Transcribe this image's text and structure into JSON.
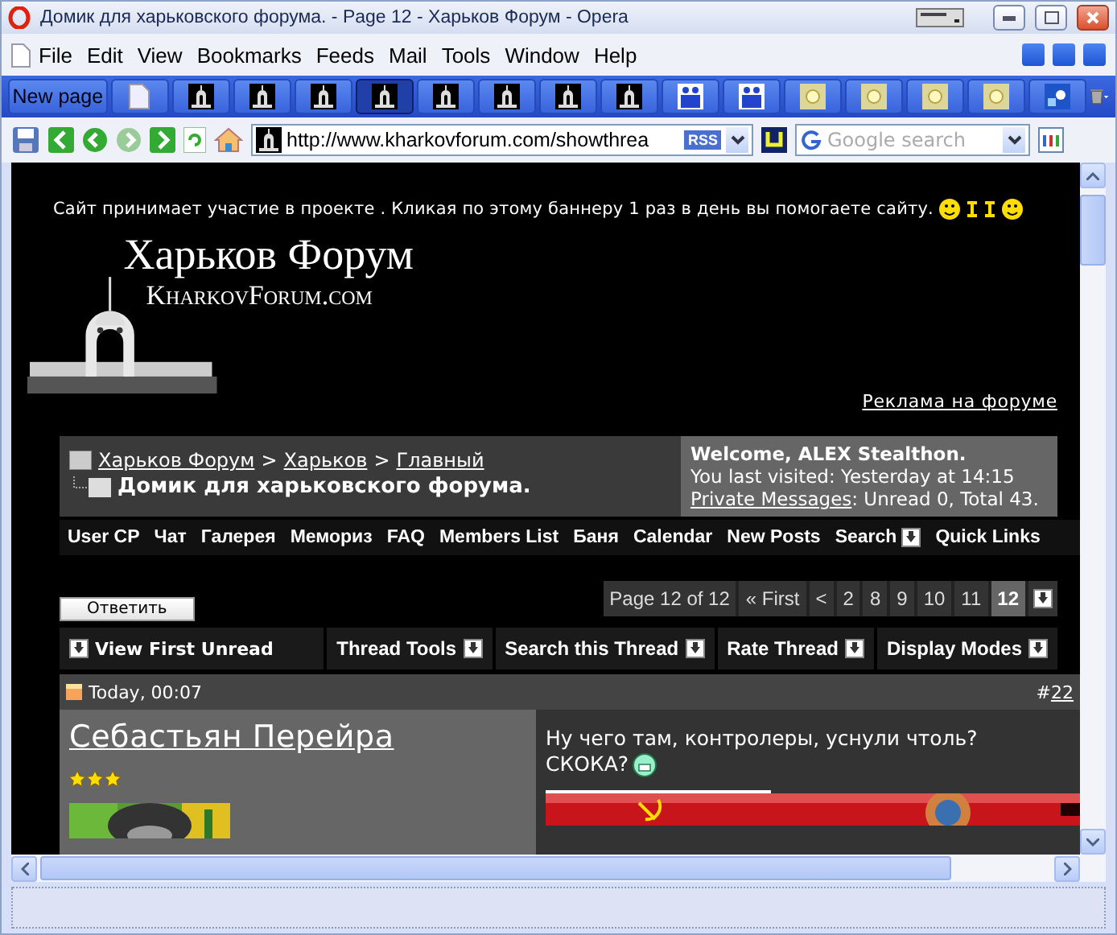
{
  "window": {
    "title": "Домик для харьковского форума. - Page 12 - Харьков Форум - Opera"
  },
  "menu": [
    "File",
    "Edit",
    "View",
    "Bookmarks",
    "Feeds",
    "Mail",
    "Tools",
    "Window",
    "Help"
  ],
  "tabs": [
    {
      "kind": "page",
      "label": "New page",
      "selected": false
    },
    {
      "kind": "blank",
      "selected": false
    },
    {
      "kind": "forum",
      "selected": false
    },
    {
      "kind": "forum",
      "selected": false
    },
    {
      "kind": "forum",
      "selected": false
    },
    {
      "kind": "forum",
      "selected": true
    },
    {
      "kind": "forum",
      "selected": false
    },
    {
      "kind": "forum",
      "selected": false
    },
    {
      "kind": "forum",
      "selected": false
    },
    {
      "kind": "forum",
      "selected": false
    },
    {
      "kind": "people",
      "selected": false
    },
    {
      "kind": "people",
      "selected": false
    },
    {
      "kind": "sun",
      "selected": false
    },
    {
      "kind": "sun",
      "selected": false
    },
    {
      "kind": "sun",
      "selected": false
    },
    {
      "kind": "sun",
      "selected": false
    },
    {
      "kind": "puzzle",
      "selected": false
    }
  ],
  "address": {
    "url": "http://www.kharkovforum.com/showthrea",
    "feed_badge": "RSS",
    "search_placeholder": "Google search"
  },
  "page": {
    "banner_notice": "Сайт принимает участие в проекте . Кликая по этому баннеру 1 раз в день вы помогаете сайту.",
    "logo_title": "Харьков Форум",
    "logo_subtitle": "KharkovForum.com",
    "ad_link": "Реклама на форуме",
    "breadcrumb_separator": ">",
    "breadcrumb": [
      "Харьков Форум",
      "Харьков",
      "Главный"
    ],
    "thread_title": "Домик для харьковского форума.",
    "welcome": {
      "greeting": "Welcome, ALEX Stealthon.",
      "last_visit": "You last visited: Yesterday at 14:15",
      "pm_link": "Private Messages",
      "pm_status": ": Unread 0, Total 43."
    },
    "nav": [
      {
        "label": "User CP",
        "menu": false
      },
      {
        "label": "Чат",
        "menu": false
      },
      {
        "label": "Галерея",
        "menu": false
      },
      {
        "label": "Мемориз",
        "menu": false
      },
      {
        "label": "FAQ",
        "menu": false
      },
      {
        "label": "Members List",
        "menu": false
      },
      {
        "label": "Баня",
        "menu": false
      },
      {
        "label": "Calendar",
        "menu": false
      },
      {
        "label": "New Posts",
        "menu": false
      },
      {
        "label": "Search",
        "menu": true
      },
      {
        "label": "Quick Links",
        "menu": false
      }
    ],
    "reply_button": "Ответить",
    "pagination": {
      "summary": "Page 12 of 12",
      "pages": [
        {
          "label": "« First",
          "selected": false
        },
        {
          "label": "<",
          "selected": false
        },
        {
          "label": "2",
          "selected": false
        },
        {
          "label": "8",
          "selected": false
        },
        {
          "label": "9",
          "selected": false
        },
        {
          "label": "10",
          "selected": false
        },
        {
          "label": "11",
          "selected": false
        },
        {
          "label": "12",
          "selected": true
        }
      ]
    },
    "thread_tools": [
      {
        "label": "View First Unread",
        "kind": "jump"
      },
      {
        "label": "Thread Tools",
        "kind": "menu"
      },
      {
        "label": "Search this Thread",
        "kind": "menu"
      },
      {
        "label": "Rate Thread",
        "kind": "menu"
      },
      {
        "label": "Display Modes",
        "kind": "menu"
      }
    ],
    "post": {
      "date": "Today, 00:07",
      "number_prefix": "#",
      "number": "22",
      "author": "Себастьян Перейра",
      "stars": 3,
      "message": [
        "Ну чего там, контролеры, уснули чтоль?",
        "СКОКА?"
      ]
    }
  }
}
